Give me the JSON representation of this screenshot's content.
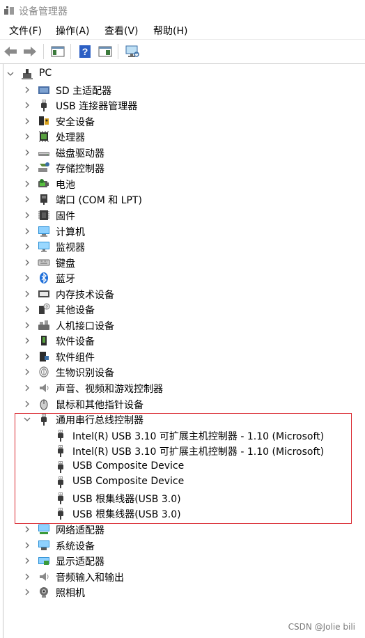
{
  "window": {
    "title": "设备管理器"
  },
  "menu": [
    "文件(F)",
    "操作(A)",
    "查看(V)",
    "帮助(H)"
  ],
  "toolbar": {
    "buttons": [
      "back-icon",
      "forward-icon",
      "show-hide-console-tree-icon",
      "help-icon",
      "properties-icon",
      "scan-hardware-icon"
    ]
  },
  "tree": {
    "root": "PC",
    "categories": [
      {
        "label": "SD 主适配器",
        "icon": "sd-host-icon"
      },
      {
        "label": "USB 连接器管理器",
        "icon": "usb-plug-icon"
      },
      {
        "label": "安全设备",
        "icon": "security-device-icon"
      },
      {
        "label": "处理器",
        "icon": "processor-icon"
      },
      {
        "label": "磁盘驱动器",
        "icon": "disk-drive-icon"
      },
      {
        "label": "存储控制器",
        "icon": "storage-controller-icon"
      },
      {
        "label": "电池",
        "icon": "battery-icon"
      },
      {
        "label": "端口 (COM 和 LPT)",
        "icon": "port-icon"
      },
      {
        "label": "固件",
        "icon": "firmware-icon"
      },
      {
        "label": "计算机",
        "icon": "computer-icon"
      },
      {
        "label": "监视器",
        "icon": "monitor-icon"
      },
      {
        "label": "键盘",
        "icon": "keyboard-icon"
      },
      {
        "label": "蓝牙",
        "icon": "bluetooth-icon"
      },
      {
        "label": "内存技术设备",
        "icon": "memory-icon"
      },
      {
        "label": "其他设备",
        "icon": "other-device-icon"
      },
      {
        "label": "人机接口设备",
        "icon": "hid-icon"
      },
      {
        "label": "软件设备",
        "icon": "software-device-icon"
      },
      {
        "label": "软件组件",
        "icon": "software-component-icon"
      },
      {
        "label": "生物识别设备",
        "icon": "biometric-icon"
      },
      {
        "label": "声音、视频和游戏控制器",
        "icon": "audio-icon"
      },
      {
        "label": "鼠标和其他指针设备",
        "icon": "mouse-icon"
      }
    ],
    "expanded": {
      "label": "通用串行总线控制器",
      "icon": "usb-plug-icon",
      "children": [
        "Intel(R) USB 3.10 可扩展主机控制器 - 1.10 (Microsoft)",
        "Intel(R) USB 3.10 可扩展主机控制器 - 1.10 (Microsoft)",
        "USB Composite Device",
        "USB Composite Device",
        "USB 根集线器(USB 3.0)",
        "USB 根集线器(USB 3.0)"
      ]
    },
    "after": [
      {
        "label": "网络适配器",
        "icon": "network-adapter-icon"
      },
      {
        "label": "系统设备",
        "icon": "system-device-icon"
      },
      {
        "label": "显示适配器",
        "icon": "display-adapter-icon"
      },
      {
        "label": "音频输入和输出",
        "icon": "audio-io-icon"
      },
      {
        "label": "照相机",
        "icon": "camera-icon"
      }
    ]
  },
  "watermark": "CSDN @Jolie bili",
  "colors": {
    "highlight": "#d9272e",
    "usbIcon": "#3a3a3a"
  }
}
